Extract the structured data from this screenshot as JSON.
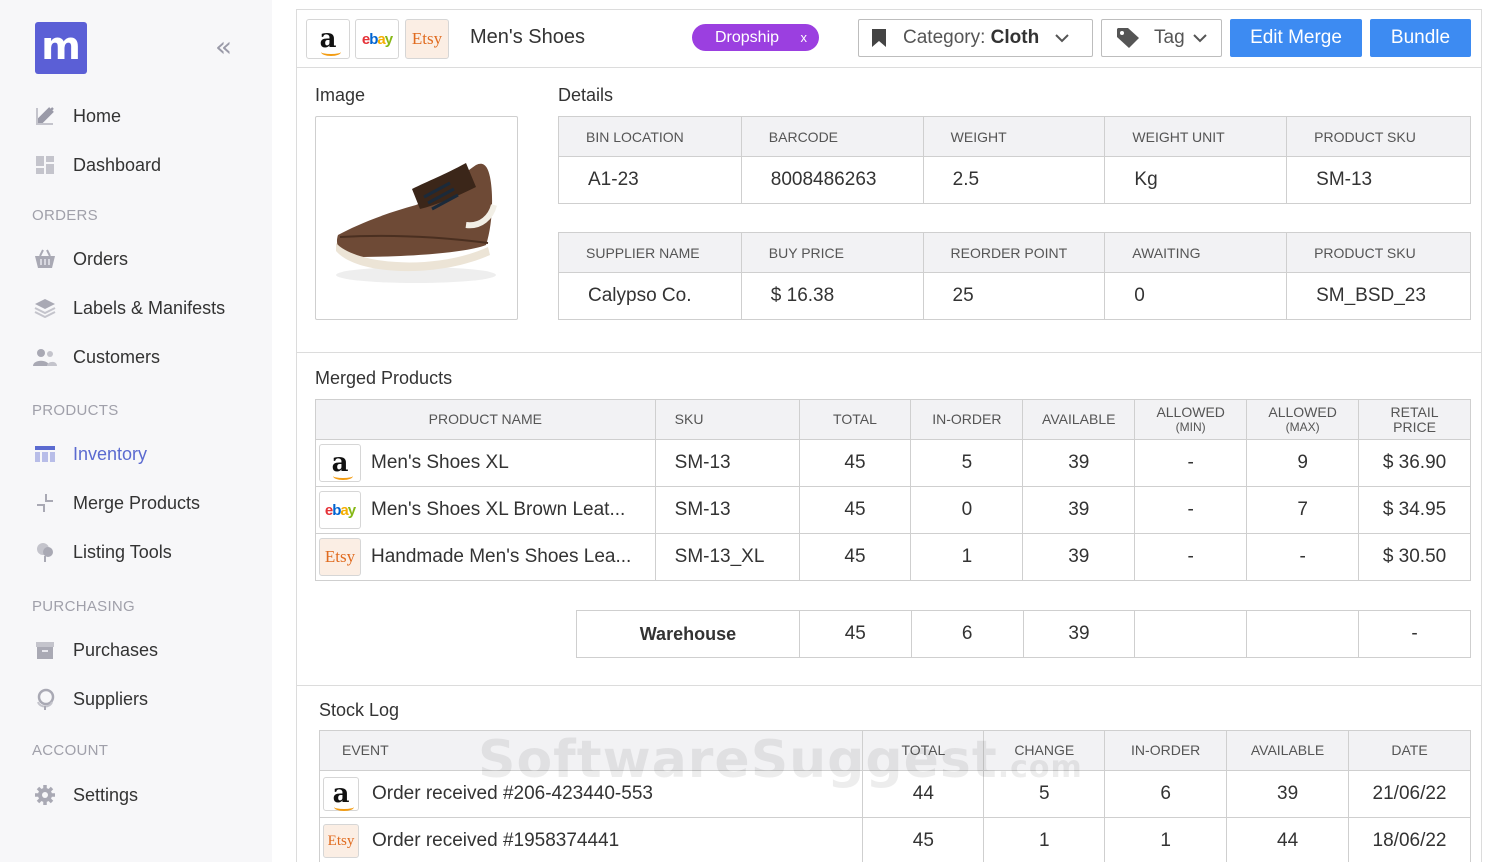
{
  "sidebar": {
    "logo_letter": "m",
    "collapse_glyph": "«",
    "nav": {
      "home": "Home",
      "dashboard": "Dashboard",
      "orders": "Orders",
      "labels": "Labels & Manifests",
      "customers": "Customers",
      "inventory": "Inventory",
      "merge": "Merge Products",
      "listing": "Listing Tools",
      "purchases": "Purchases",
      "suppliers": "Suppliers",
      "settings": "Settings"
    },
    "sections": {
      "orders": "ORDERS",
      "products": "PRODUCTS",
      "purchasing": "PURCHASING",
      "account": "ACCOUNT"
    },
    "active_color": "#5b6ad0"
  },
  "topbar": {
    "marketplaces": {
      "amazon": "a",
      "ebay": "ebay",
      "etsy": "Etsy"
    },
    "product_title": "Men's Shoes",
    "dropship_badge": "Dropship",
    "badge_close": "x",
    "category_prefix": "Category: ",
    "category_value": "Cloth",
    "tag_label": "Tag",
    "edit_merge": "Edit Merge",
    "bundle": "Bundle",
    "button_color": "#3d8bf2",
    "badge_color": "#9b3fe0"
  },
  "image_section": {
    "title": "Image"
  },
  "details": {
    "title": "Details",
    "table1": {
      "headers": [
        "BIN LOCATION",
        "BARCODE",
        "WEIGHT",
        "WEIGHT UNIT",
        "PRODUCT SKU"
      ],
      "values": [
        "A1-23",
        "8008486263",
        "2.5",
        "Kg",
        "SM-13"
      ]
    },
    "table2": {
      "headers": [
        "SUPPLIER NAME",
        "BUY PRICE",
        "REORDER POINT",
        "AWAITING",
        "PRODUCT SKU"
      ],
      "values": [
        "Calypso Co.",
        "$ 16.38",
        "25",
        "0",
        "SM_BSD_23"
      ]
    }
  },
  "merged": {
    "title": "Merged Products",
    "headers": {
      "name": "PRODUCT NAME",
      "sku": "SKU",
      "total": "TOTAL",
      "in_order": "IN-ORDER",
      "available": "AVAILABLE",
      "allowed_min": "ALLOWED",
      "allowed_min_sub": "(MIN)",
      "allowed_max": "ALLOWED",
      "allowed_max_sub": "(MAX)",
      "retail": "RETAIL",
      "retail_sub": "PRICE"
    },
    "rows": [
      {
        "marketplace": "amazon",
        "name": "Men's Shoes XL",
        "sku": "SM-13",
        "total": "45",
        "in_order": "5",
        "available": "39",
        "min": "-",
        "max": "9",
        "price": "$ 36.90"
      },
      {
        "marketplace": "ebay",
        "name": "Men's Shoes XL Brown Leat...",
        "sku": "SM-13",
        "total": "45",
        "in_order": "0",
        "available": "39",
        "min": "-",
        "max": "7",
        "price": "$ 34.95"
      },
      {
        "marketplace": "etsy",
        "name": "Handmade Men's Shoes Lea...",
        "sku": "SM-13_XL",
        "total": "45",
        "in_order": "1",
        "available": "39",
        "min": "-",
        "max": "-",
        "price": "$ 30.50"
      }
    ],
    "warehouse": {
      "label": "Warehouse",
      "total": "45",
      "in_order": "6",
      "available": "39",
      "min": "",
      "max": "",
      "price": "-"
    }
  },
  "stock_log": {
    "title": "Stock Log",
    "headers": [
      "EVENT",
      "TOTAL",
      "CHANGE",
      "IN-ORDER",
      "AVAILABLE",
      "DATE"
    ],
    "rows": [
      {
        "marketplace": "amazon",
        "event": "Order received #206-423440-553",
        "total": "44",
        "change": "5",
        "in_order": "6",
        "available": "39",
        "date": "21/06/22"
      },
      {
        "marketplace": "etsy",
        "event": "Order received #1958374441",
        "total": "45",
        "change": "1",
        "in_order": "1",
        "available": "44",
        "date": "18/06/22"
      }
    ]
  },
  "watermark": {
    "main": "SoftwareSuggest",
    "suffix": ".com"
  }
}
